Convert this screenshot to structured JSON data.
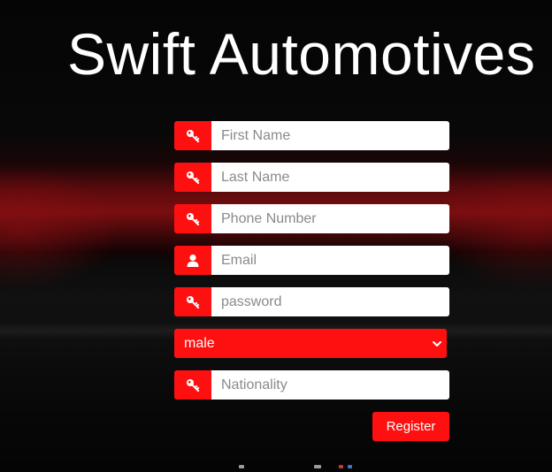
{
  "page": {
    "title": "Swift Automotives"
  },
  "form": {
    "fields": [
      {
        "placeholder": "First Name",
        "icon": "key-icon"
      },
      {
        "placeholder": "Last Name",
        "icon": "key-icon"
      },
      {
        "placeholder": "Phone Number",
        "icon": "key-icon"
      },
      {
        "placeholder": "Email",
        "icon": "user-icon"
      },
      {
        "placeholder": "password",
        "icon": "key-icon"
      }
    ],
    "gender": {
      "selected": "male"
    },
    "nationality": {
      "placeholder": "Nationality",
      "icon": "key-icon"
    },
    "register_label": "Register"
  },
  "colors": {
    "accent": "#ff1010",
    "title": "#ffffff",
    "input_bg": "#ffffff",
    "placeholder": "#8a8a8a"
  }
}
